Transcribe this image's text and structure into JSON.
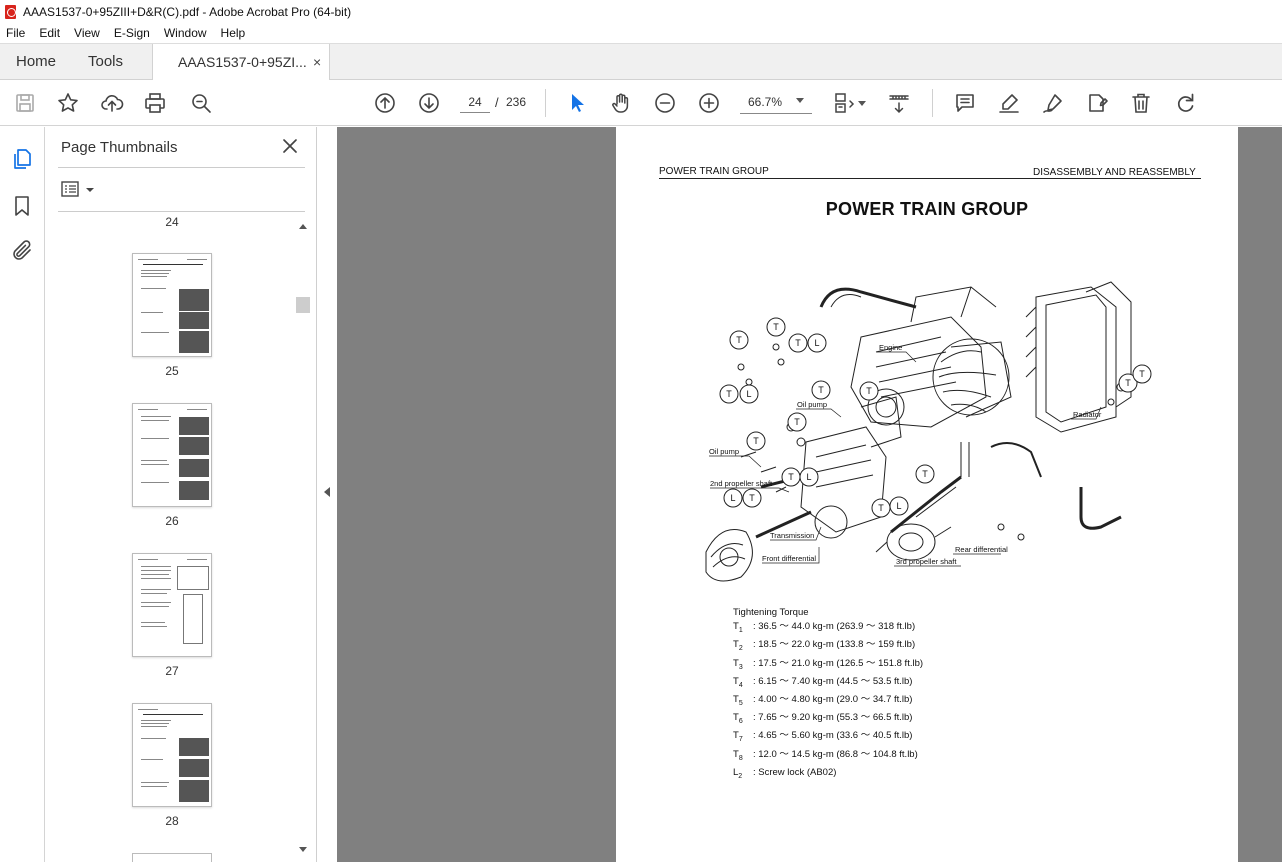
{
  "window": {
    "title": "AAAS1537-0+95ZIII+D&R(C).pdf - Adobe Acrobat Pro (64-bit)"
  },
  "menu": [
    "File",
    "Edit",
    "View",
    "E-Sign",
    "Window",
    "Help"
  ],
  "tabs": {
    "home": "Home",
    "tools": "Tools",
    "document": "AAAS1537-0+95ZI...",
    "close": "×"
  },
  "toolbar": {
    "page_current": "24",
    "page_separator": "/",
    "page_total": "236",
    "zoom": "66.7%"
  },
  "thumbnails": {
    "title": "Page Thumbnails",
    "pages": [
      {
        "label": "24"
      },
      {
        "label": "25"
      },
      {
        "label": "26"
      },
      {
        "label": "27"
      },
      {
        "label": "28"
      }
    ]
  },
  "document": {
    "header_left": "POWER TRAIN GROUP",
    "header_right": "DISASSEMBLY AND REASSEMBLY",
    "heading": "POWER TRAIN GROUP",
    "callouts": {
      "engine": "Engine",
      "oil_pump_upper": "Oil pump",
      "oil_pump_lower": "Oil pump",
      "radiator": "Radiator",
      "second_shaft": "2nd propeller shaft",
      "transmission": "Transmission",
      "front_diff": "Front differential",
      "rear_diff": "Rear differential",
      "third_shaft": "3rd propeller shaft"
    },
    "torque": {
      "title": "Tightening Torque",
      "rows": [
        {
          "sym": "T",
          "sub": "1",
          "value": ": 36.5 ～ 44.0 kg-m (263.9 ～ 318 ft.lb)"
        },
        {
          "sym": "T",
          "sub": "2",
          "value": ": 18.5 ～ 22.0 kg-m (133.8 ～ 159 ft.lb)"
        },
        {
          "sym": "T",
          "sub": "3",
          "value": ": 17.5 ～ 21.0 kg-m (126.5 ～ 151.8 ft.lb)"
        },
        {
          "sym": "T",
          "sub": "4",
          "value": ": 6.15 ～ 7.40 kg-m (44.5 ～ 53.5 ft.lb)"
        },
        {
          "sym": "T",
          "sub": "5",
          "value": ": 4.00 ～ 4.80 kg-m (29.0 ～ 34.7 ft.lb)"
        },
        {
          "sym": "T",
          "sub": "6",
          "value": ": 7.65 ～ 9.20 kg-m (55.3 ～ 66.5 ft.lb)"
        },
        {
          "sym": "T",
          "sub": "7",
          "value": ": 4.65 ～ 5.60 kg-m (33.6 ～ 40.5 ft.lb)"
        },
        {
          "sym": "T",
          "sub": "8",
          "value": ": 12.0 ～ 14.5 kg-m (86.8 ～ 104.8 ft.lb)"
        },
        {
          "sym": "L",
          "sub": "2",
          "value": ": Screw lock (AB02)"
        }
      ]
    }
  },
  "colors": {
    "accent": "#1473e6",
    "canvas": "#808080",
    "pdf_red": "#d8241c"
  }
}
